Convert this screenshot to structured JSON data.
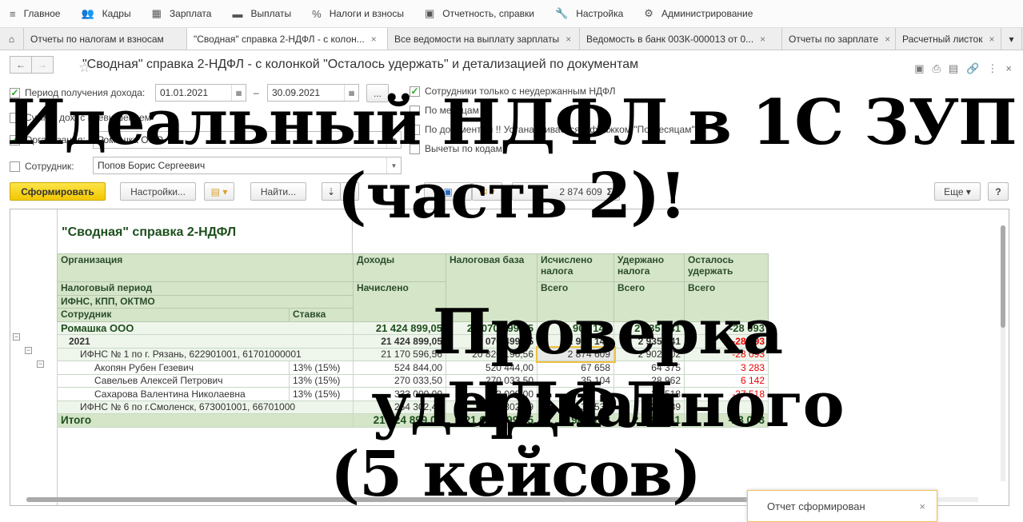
{
  "menu": [
    "Главное",
    "Кадры",
    "Зарплата",
    "Выплаты",
    "Налоги и взносы",
    "Отчетность, справки",
    "Настройка",
    "Администрирование"
  ],
  "menu_icons": [
    "≡",
    "👥",
    "▦",
    "▬",
    "%",
    "▣",
    "🔧",
    "⚙"
  ],
  "tabs": [
    "Отчеты по налогам и взносам",
    "\"Сводная\" справка 2-НДФЛ - с колон...",
    "Все ведомости на выплату зарплаты",
    "Ведомость в банк 00ЗК-000013 от 0...",
    "Отчеты по зарплате",
    "Расчетный листок"
  ],
  "window_title": "\"Сводная\" справка 2-НДФЛ - с колонкой \"Осталось удержать\" и детализацией по документам",
  "filters": {
    "period_label": "Период получения дохода:",
    "period_from": "01.01.2021",
    "period_dash": "–",
    "period_to": "30.09.2021",
    "period_btn": "...",
    "sums_label": "Суммы дох. с превышением",
    "org_label": "Организация:",
    "org_value": "Ромашка ООО",
    "emp_label": "Сотрудник:",
    "emp_value": "Попов Борис Сергеевич",
    "only_unwithheld": "Сотрудники только с неудержанным НДФЛ",
    "by_month": "По месяцам",
    "by_docs": "По документам !! Устанавливается с флажком \"По месяцам\" !!",
    "deductions": "Вычеты по кодам"
  },
  "toolbar": {
    "generate": "Сформировать",
    "settings": "Настройки...",
    "find": "Найти...",
    "sum_value": "2 874 609",
    "sum_icon": "Σ",
    "more": "Еще",
    "help": "?"
  },
  "report": {
    "title": "\"Сводная\" справка 2-НДФЛ",
    "headers": {
      "org": "Организация",
      "income": "Доходы",
      "taxbase": "Налоговая база",
      "calc": "Исчислено налога",
      "withheld": "Удержано налога",
      "remain": "Осталось удержать",
      "period": "Налоговый период",
      "accrued": "Начислено",
      "total1": "Всего",
      "total2": "Всего",
      "total3": "Всего",
      "ifns": "ИФНС, КПП, ОКТМО",
      "employee": "Сотрудник",
      "rate": "Ставка"
    },
    "rows": [
      {
        "type": "org",
        "name": "Ромашка ООО",
        "rate": "",
        "income": "21 424 899,05",
        "base": "21 070 499,05",
        "calc": "2 907 148",
        "withheld": "2 935 241",
        "remain": "-28 093"
      },
      {
        "type": "yr",
        "name": "2021",
        "rate": "",
        "income": "21 424 899,05",
        "base": "21 070 499,05",
        "calc": "2 907 148",
        "withheld": "2 935 241",
        "remain": "-28 093"
      },
      {
        "type": "ifns",
        "name": "ИФНС № 1 по г. Рязань, 622901001, 61701000001",
        "rate": "",
        "income": "21 170 596,56",
        "base": "20 820 196,56",
        "calc": "2 874 609",
        "withheld": "2 902 702",
        "remain": "-28 093"
      },
      {
        "type": "emp",
        "name": "Акопян Рубен Гезевич",
        "rate": "13% (15%)",
        "income": "524 844,00",
        "base": "520 444,00",
        "calc": "67 658",
        "withheld": "64 375",
        "remain": "3 283"
      },
      {
        "type": "emp",
        "name": "Савельев Алексей Петрович",
        "rate": "13% (15%)",
        "income": "270 033,50",
        "base": "270 033,50",
        "calc": "35 104",
        "withheld": "28 962",
        "remain": "6 142"
      },
      {
        "type": "emp",
        "name": "Сахарова Валентина Николаевна",
        "rate": "13% (15%)",
        "income": "333 000,00",
        "base": "333 000,00",
        "calc": "",
        "withheld": "37 518",
        "remain": "-37 518"
      },
      {
        "type": "ifns",
        "name": "ИФНС № 6 по г.Смоленск, 673001001, 66701000",
        "rate": "",
        "income": "254 302,49",
        "base": "250 302,49",
        "calc": "32 539",
        "withheld": "32 539",
        "remain": ""
      }
    ],
    "total": {
      "name": "Итого",
      "income": "21 424 899,05",
      "base": "21 070 499,05",
      "calc": "2 907 148",
      "withheld": "2 935 241",
      "remain": "-28 093"
    }
  },
  "notification": "Отчет сформирован",
  "overlay": [
    "Идеальный НДФЛ в 1С ЗУП",
    "(часть 2)!",
    "Проверка удержанного",
    "НДФЛ",
    "(5 кейсов)"
  ]
}
